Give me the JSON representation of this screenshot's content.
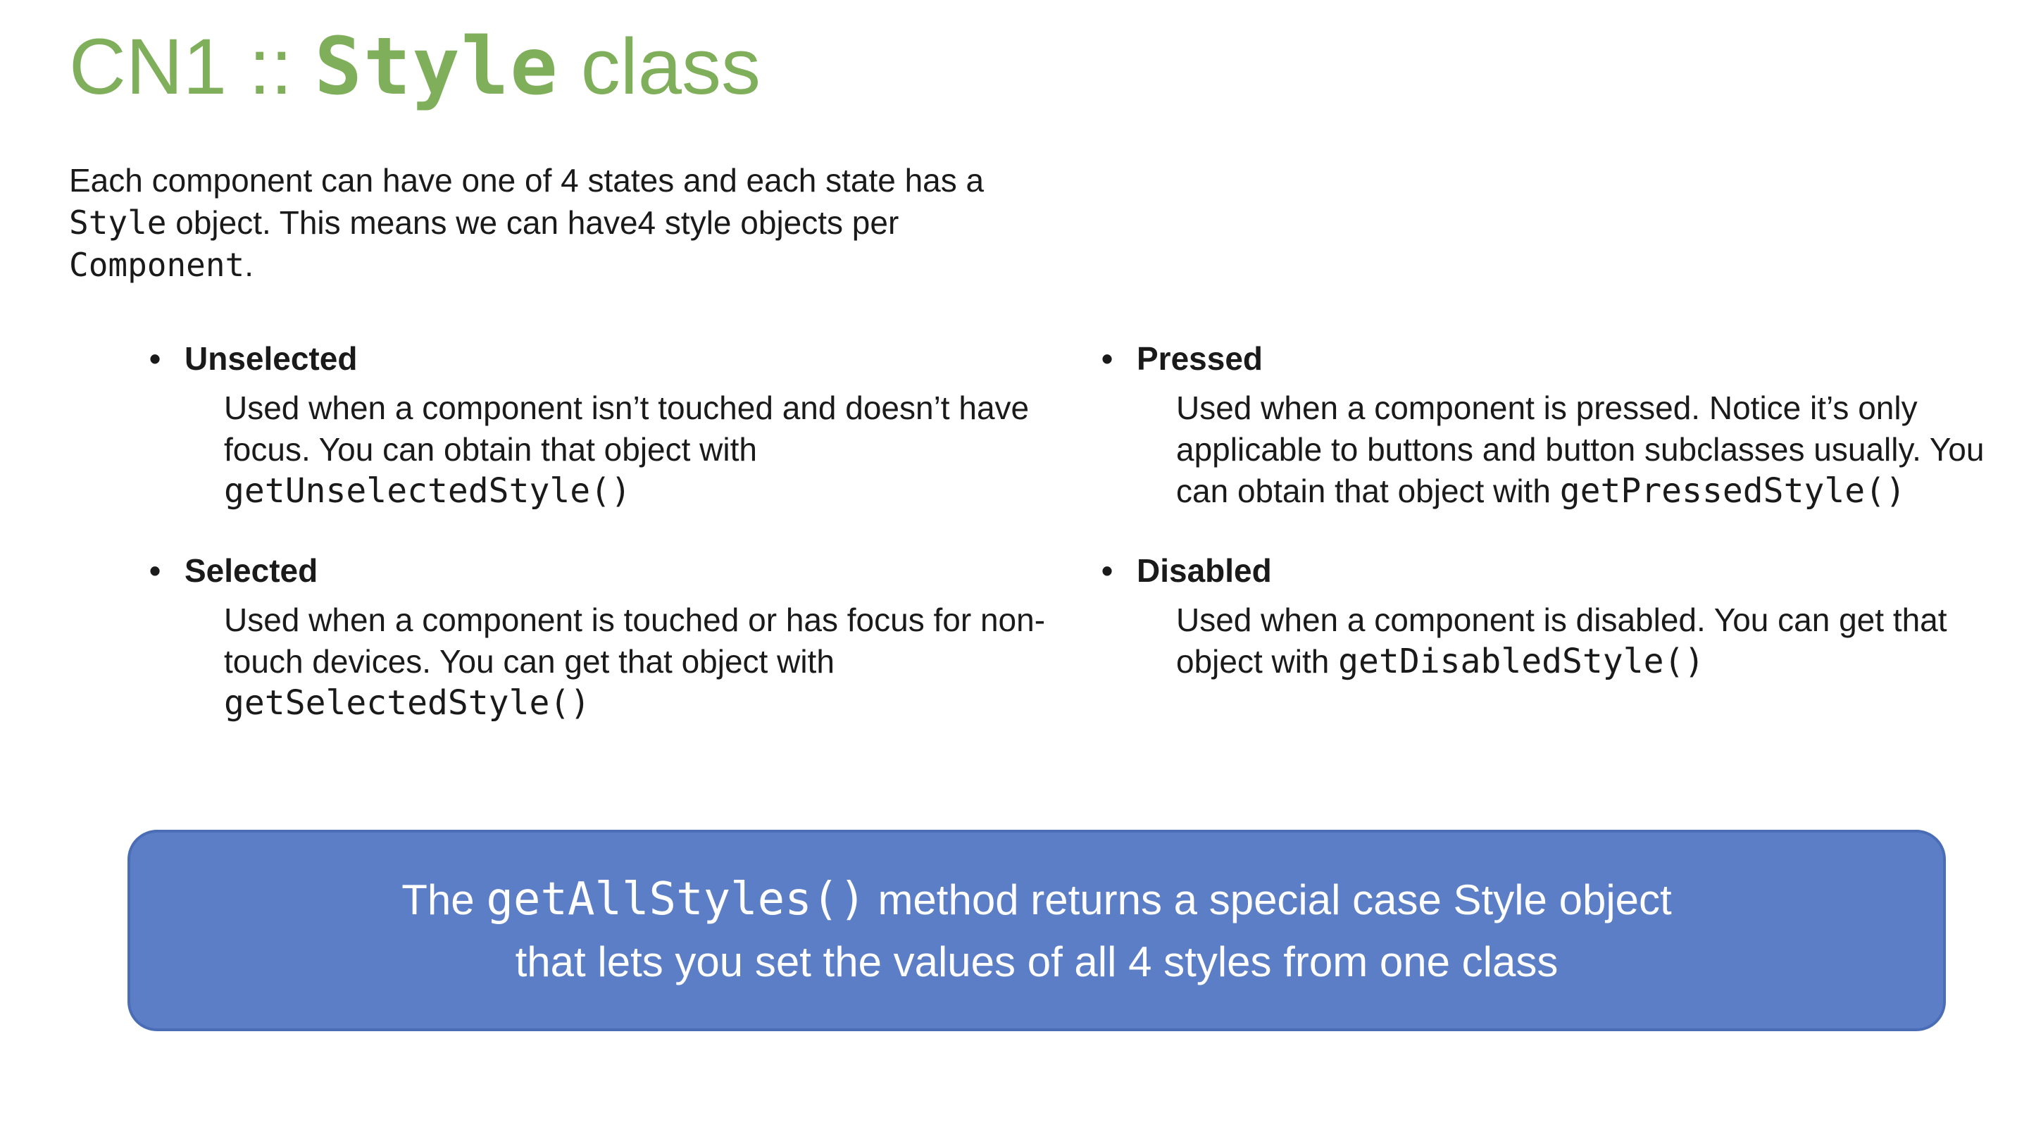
{
  "colors": {
    "title_accent": "#7faf5a",
    "callout_background": "#5b7ec7",
    "callout_border": "#4a6db6",
    "callout_text": "#ffffff"
  },
  "title": {
    "prefix": "CN1 :: ",
    "code": "Style",
    "suffix": " class"
  },
  "intro": {
    "part1": "Each component can have one of 4 states and each state has a ",
    "code1": "Style",
    "part2": " object. This means we can have4 style objects per ",
    "code2": "Component",
    "part3": "."
  },
  "states": [
    {
      "bullet": "•",
      "name": "Unselected",
      "description": "Used when a component isn’t touched and doesn’t have focus. You can obtain that object with ",
      "method": "getUnselectedStyle()"
    },
    {
      "bullet": "•",
      "name": "Selected",
      "description": "Used when a component is touched or has focus for non-touch devices. You can get that object with ",
      "method": "getSelectedStyle()"
    },
    {
      "bullet": "•",
      "name": "Pressed",
      "description": "Used when a component is pressed. Notice it’s only applicable to buttons and button subclasses usually. You can obtain that object with ",
      "method": "getPressedStyle()"
    },
    {
      "bullet": "•",
      "name": "Disabled",
      "description": "Used when a component is disabled. You can get that object with ",
      "method": "getDisabledStyle()"
    }
  ],
  "callout": {
    "line1_prefix": "The ",
    "line1_code": "getAllStyles()",
    "line1_suffix": " method returns a special case Style object",
    "line2": "that lets you set the values of all 4 styles from one class"
  }
}
